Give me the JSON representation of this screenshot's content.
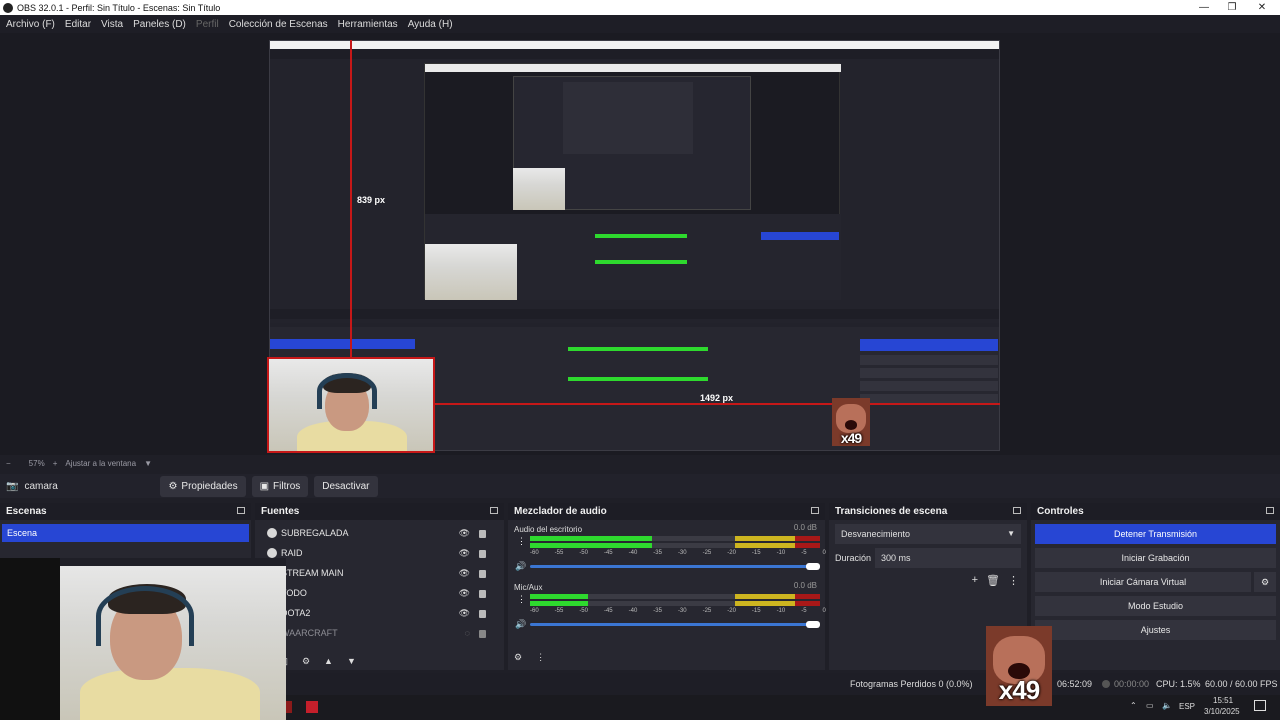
{
  "window": {
    "title": "OBS 32.0.1 - Perfil: Sin Título - Escenas: Sin Título"
  },
  "menubar": [
    "Archivo (F)",
    "Editar",
    "Vista",
    "Paneles (D)",
    "Perfil",
    "Colección de Escenas",
    "Herramientas",
    "Ayuda (H)"
  ],
  "preview": {
    "measure_vertical": "839 px",
    "measure_horizontal": "1492 px",
    "overlay_text": "x49"
  },
  "zoombar": {
    "minus": "−",
    "zoom": "57%",
    "plus": "+",
    "fit_label": "Ajustar a la ventana"
  },
  "source_toolbar": {
    "selected_source": "camara",
    "properties": "Propiedades",
    "filters": "Filtros",
    "deactivate": "Desactivar"
  },
  "scenes": {
    "title": "Escenas",
    "items": [
      "Escena"
    ]
  },
  "sources": {
    "title": "Fuentes",
    "items": [
      "SUBREGALADA",
      "RAID",
      "STREAM MAIN",
      "TODO",
      "DOTA2",
      "WAARCRAFT"
    ]
  },
  "mixer": {
    "title": "Mezclador de audio",
    "channels": [
      {
        "name": "Audio del escritorio",
        "db": "0.0 dB",
        "level": 0.42
      },
      {
        "name": "Mic/Aux",
        "db": "0.0 dB",
        "level": 0.2
      }
    ],
    "ticks": [
      "-60",
      "-55",
      "-50",
      "-45",
      "-40",
      "-35",
      "-30",
      "-25",
      "-20",
      "-15",
      "-10",
      "-5",
      "0"
    ]
  },
  "transitions": {
    "title": "Transiciones de escena",
    "selected": "Desvanecimiento",
    "duration_label": "Duración",
    "duration_value": "300 ms"
  },
  "controls": {
    "title": "Controles",
    "stop_stream": "Detener Transmisión",
    "start_recording": "Iniciar Grabación",
    "start_virtual_cam": "Iniciar Cámara Virtual",
    "studio_mode": "Modo Estudio",
    "settings": "Ajustes"
  },
  "statusbar": {
    "dropped_frames": "Fotogramas Perdidos 0 (0.0%)",
    "stream_time": "06:52:09",
    "rec_time": "00:00:00",
    "cpu": "CPU: 1.5%",
    "fps": "60.00 / 60.00 FPS"
  },
  "taskbar": {
    "lang": "ESP",
    "time": "15:51",
    "date": "3/10/2025"
  },
  "badge_text": "x49"
}
